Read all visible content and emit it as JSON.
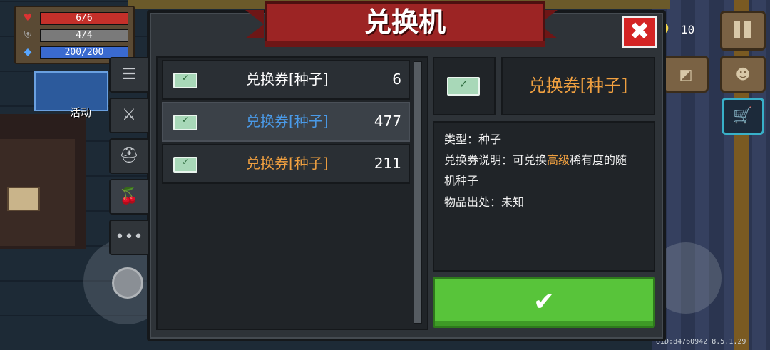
{
  "hud": {
    "hp": {
      "current": 6,
      "max": 6,
      "text": "6/6",
      "fraction": 1.0,
      "icon": "heart-icon",
      "color": "#c4302a"
    },
    "armor": {
      "current": 4,
      "max": 4,
      "text": "4/4",
      "fraction": 1.0,
      "icon": "shield-icon",
      "color": "#7a7a7a"
    },
    "energy": {
      "current": 200,
      "max": 200,
      "text": "200/200",
      "fraction": 1.0,
      "icon": "diamond-icon",
      "color": "#3a6ad0"
    }
  },
  "scene": {
    "activity_label": "活动",
    "gems": "10",
    "uid": "UID:84760942 8.5.1.29"
  },
  "dialog": {
    "title": "兑换机",
    "close_symbol": "✖",
    "tabs": [
      {
        "icon": "list-icon",
        "symbol": "☰",
        "active": false
      },
      {
        "icon": "weapon-icon",
        "symbol": "⚔",
        "active": false
      },
      {
        "icon": "helmet-icon",
        "symbol": "⛑",
        "active": false
      },
      {
        "icon": "seed-icon",
        "symbol": "🍒",
        "active": true
      },
      {
        "icon": "more-icon",
        "symbol": "•••",
        "active": false
      }
    ],
    "items": [
      {
        "name": "兑换券[种子]",
        "qty": "6",
        "color": "#ffffff",
        "selected": false
      },
      {
        "name": "兑换券[种子]",
        "qty": "477",
        "color": "#4a9ae8",
        "selected": true
      },
      {
        "name": "兑换券[种子]",
        "qty": "211",
        "color": "#f0a040",
        "selected": false
      }
    ],
    "detail": {
      "name": "兑换券[种子]",
      "type_line": "类型：种子",
      "desc_prefix": "兑换券说明：可兑换",
      "desc_highlight": "高级",
      "desc_suffix_1": "稀有度的随",
      "desc_suffix_2": "机种子",
      "source_line": "物品出处：未知"
    },
    "confirm_symbol": "✔"
  }
}
